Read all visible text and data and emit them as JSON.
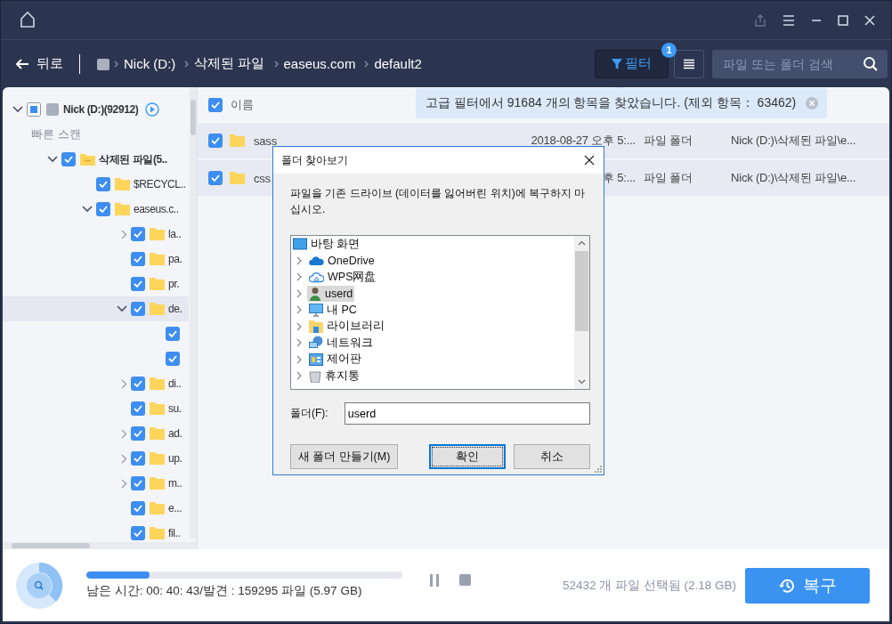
{
  "nav": {
    "back": "뒤로",
    "breadcrumb": [
      "Nick (D:)",
      "삭제된 파일",
      "easeus.com",
      "default2"
    ],
    "filter": {
      "label": "필터",
      "badge": "1"
    },
    "search": {
      "placeholder": "파일 또는 폴더 검색"
    }
  },
  "notice": {
    "text": "고급 필터에서 91684 개의 항목을 찾았습니다. (제외 항목： 63462)"
  },
  "tree": [
    {
      "kind": "drive",
      "label": "Nick (D:)(92912)",
      "checked": false,
      "partial": true,
      "expanded": true,
      "selected": false,
      "children": [
        {
          "kind": "section",
          "label": "빠른 스캔",
          "children": [
            {
              "kind": "deleted",
              "label": "삭제된 파일(5..",
              "checked": true,
              "expanded": true,
              "selected": false,
              "children": [
                {
                  "kind": "folder",
                  "label": "$RECYCL..",
                  "checked": true,
                  "selected": false
                },
                {
                  "kind": "folder",
                  "label": "easeus.c..",
                  "checked": true,
                  "expanded": true,
                  "selected": false,
                  "children": [
                    {
                      "kind": "folder",
                      "label": "la..",
                      "checked": true,
                      "expanded": false,
                      "selected": false
                    },
                    {
                      "kind": "folder",
                      "label": "pa.",
                      "checked": true,
                      "selected": false
                    },
                    {
                      "kind": "folder",
                      "label": "pr.",
                      "checked": true,
                      "selected": false
                    },
                    {
                      "kind": "folder",
                      "label": "de.",
                      "checked": true,
                      "expanded": true,
                      "selected": true,
                      "children": [
                        {
                          "checked": true,
                          "selected": false
                        },
                        {
                          "checked": true,
                          "selected": false
                        }
                      ]
                    },
                    {
                      "kind": "folder",
                      "label": "di..",
                      "checked": true,
                      "expanded": false,
                      "selected": false
                    },
                    {
                      "kind": "folder",
                      "label": "su.",
                      "checked": true,
                      "selected": false
                    },
                    {
                      "kind": "folder",
                      "label": "ad.",
                      "checked": true,
                      "expanded": false,
                      "selected": false
                    },
                    {
                      "kind": "folder",
                      "label": "up.",
                      "checked": true,
                      "expanded": false,
                      "selected": false
                    },
                    {
                      "kind": "folder",
                      "label": "m..",
                      "checked": true,
                      "expanded": false,
                      "selected": false
                    },
                    {
                      "kind": "folder",
                      "label": "e...",
                      "checked": true,
                      "selected": false
                    },
                    {
                      "kind": "folder",
                      "label": "fil..",
                      "checked": true,
                      "selected": false
                    }
                  ]
                }
              ]
            }
          ]
        }
      ]
    }
  ],
  "table": {
    "header": {
      "label": "이름",
      "checked": true
    },
    "rows": [
      {
        "name": "sass",
        "checked": true,
        "date": "2018-08-27 오후 5:...",
        "type": "파일 폴더",
        "path": "Nick (D:)\\삭제된 파일\\e..."
      },
      {
        "name": "css",
        "checked": true,
        "date": "후 5:...",
        "type": "파일 폴더",
        "path": "Nick (D:)\\삭제된 파일\\e..."
      }
    ]
  },
  "footer": {
    "level": 0.2,
    "status": "남은 시간: 00: 40: 43/발견 : 159295 파일 (5.97 GB)",
    "selected": "52432 개 파일 선택됨 (2.18 GB)",
    "recover": "복구"
  },
  "dialog": {
    "title": "폴더 찾아보기",
    "message": "파일을 기존 드라이브 (데이터를 잃어버린 위치)에 복구하지 마십시오.",
    "items": [
      {
        "kind": "desktop",
        "label": "바탕 화면",
        "expandable": false,
        "selected": false
      },
      {
        "kind": "cloud",
        "label": "OneDrive",
        "expandable": true,
        "selected": false
      },
      {
        "kind": "cloud-outline",
        "label": "WPS网盘",
        "expandable": true,
        "selected": false
      },
      {
        "kind": "user",
        "label": "userd",
        "expandable": true,
        "selected": true
      },
      {
        "kind": "pc",
        "label": "내 PC",
        "expandable": true,
        "selected": false
      },
      {
        "kind": "library",
        "label": "라이브러리",
        "expandable": true,
        "selected": false
      },
      {
        "kind": "network",
        "label": "네트워크",
        "expandable": true,
        "selected": false
      },
      {
        "kind": "control",
        "label": "제어판",
        "expandable": true,
        "selected": false
      },
      {
        "kind": "trash",
        "label": "휴지통",
        "expandable": true,
        "selected": false
      }
    ],
    "folder_label": "폴더(F):",
    "folder_value": "userd",
    "buttons": [
      {
        "label": "새 폴더 만들기(M)",
        "default": false
      },
      {
        "label": "확인",
        "default": true
      },
      {
        "label": "취소",
        "default": false
      }
    ]
  }
}
